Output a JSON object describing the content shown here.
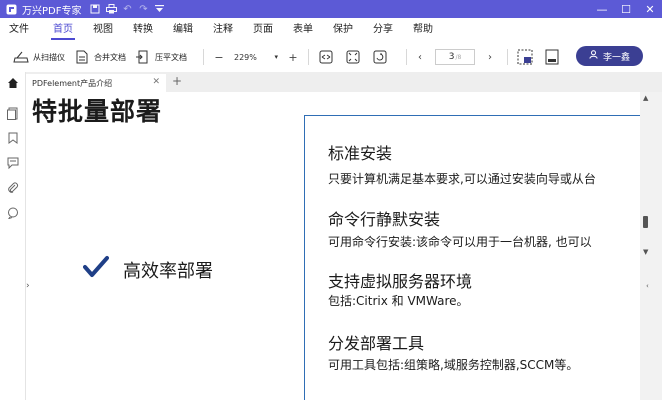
{
  "app": {
    "title": "万兴PDF专家"
  },
  "window": {
    "minimize": "—",
    "maximize": "☐",
    "close": "✕"
  },
  "menu": [
    "文件",
    "首页",
    "视图",
    "转换",
    "编辑",
    "注释",
    "页面",
    "表单",
    "保护",
    "分享",
    "帮助"
  ],
  "active_menu": "首页",
  "toolbar": {
    "scan_label": "从扫描仪",
    "merge_label": "合并文档",
    "compress_label": "压平文档",
    "zoom_out": "−",
    "zoom_value": "229%",
    "zoom_in": "+",
    "page_prev": "‹",
    "page_current": "3",
    "page_total": "/8",
    "page_next": "›"
  },
  "user": {
    "name": "李一鑫"
  },
  "tab": {
    "title": "PDFelement产品介绍",
    "close": "✕",
    "add": "+"
  },
  "document": {
    "heading": "特批量部署",
    "checkmark_text": "高效率部署",
    "items": [
      {
        "title": "标准安装",
        "desc": "只要计算机满足基本要求,可以通过安装向导或从台"
      },
      {
        "title": "命令行静默安装",
        "desc": "可用命令行安装:该命令可以用于一台机器, 也可以"
      },
      {
        "title": "支持虚拟服务器环境",
        "desc": "包括:Citrix 和 VMWare。"
      },
      {
        "title": "分发部署工具",
        "desc": "可用工具包括:组策略,域服务控制器,SCCM等。"
      }
    ]
  },
  "colors": {
    "titlebar": "#5c5ad6",
    "accent": "#4c4ad1",
    "user_button": "#3b3f93",
    "card_border": "#2f6eb5",
    "check": "#1f3f87"
  }
}
